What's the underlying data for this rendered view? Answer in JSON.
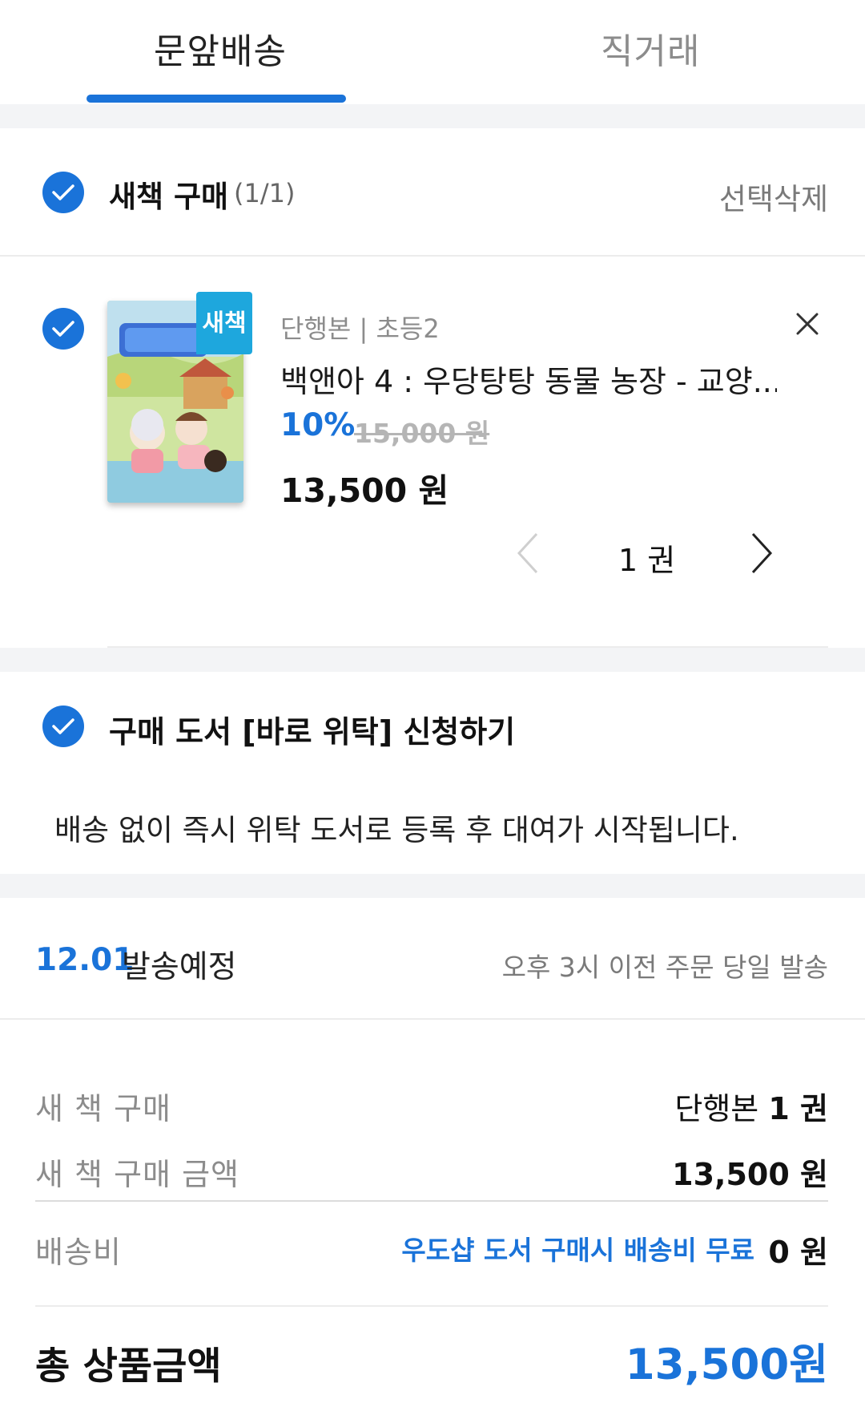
{
  "tabs": [
    {
      "label": "문앞배송",
      "active": true
    },
    {
      "label": "직거래",
      "active": false
    }
  ],
  "colors": {
    "accent": "#1a73d9",
    "badge": "#1ea7dd"
  },
  "section": {
    "title": "새책 구매",
    "count": "(1/1)",
    "delete_label": "선택삭제"
  },
  "item": {
    "badge": "새책",
    "category": "단행본 | 초등2",
    "title": "백앤아 4 : 우당탕탕 동물 농장 - 교양...",
    "discount": "10%",
    "original_price": "15,000 원",
    "price": "13,500 원",
    "quantity": "1 권",
    "icons": {
      "close": "close-icon",
      "prev": "chevron-left-icon",
      "next": "chevron-right-icon"
    }
  },
  "consign": {
    "title": "구매 도서 [바로 위탁] 신청하기",
    "description": "배송 없이 즉시 위탁 도서로 등록 후 대여가 시작됩니다."
  },
  "shipping": {
    "date": "12.01",
    "label": "발송예정",
    "note": "오후 3시 이전 주문 당일 발송"
  },
  "summary": {
    "rows": [
      {
        "label": "새 책 구매",
        "value_prefix": "단행본",
        "value": "1 권"
      },
      {
        "label": "새 책 구매 금액",
        "value": "13,500 원"
      },
      {
        "label": "배송비",
        "note": "우도샵 도서 구매시 배송비 무료",
        "value": "0 원"
      }
    ],
    "total_label": "총 상품금액",
    "total_value": "13,500원"
  }
}
